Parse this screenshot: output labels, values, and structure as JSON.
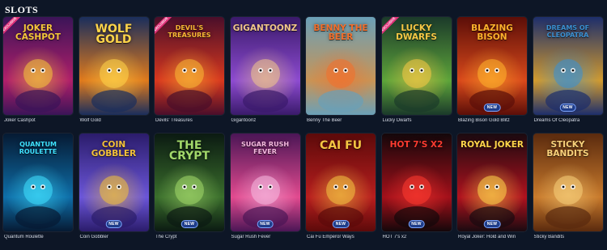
{
  "section": {
    "title": "SLOTS"
  },
  "games": [
    {
      "name": "Joker Cashpot",
      "logo": "JOKER CASHPOT",
      "tag": "EXCLUSIVE",
      "new": false
    },
    {
      "name": "Wolf Gold",
      "logo": "WOLF GOLD",
      "tag": "",
      "new": false
    },
    {
      "name": "Devils' Treasures",
      "logo": "DEVIL'S TREASURES",
      "tag": "EXCLUSIVE",
      "new": false
    },
    {
      "name": "Gigantoonz",
      "logo": "GIGANTOONZ",
      "tag": "",
      "new": false
    },
    {
      "name": "Benny The Beer",
      "logo": "BENNY the BEER",
      "tag": "",
      "new": false
    },
    {
      "name": "Lucky Dwarfs",
      "logo": "LUCKY DWARFS",
      "tag": "EXCLUSIVE",
      "new": false
    },
    {
      "name": "Blazing Bison Gold Blitz",
      "logo": "BLAZING BISON",
      "tag": "",
      "new": true
    },
    {
      "name": "Dreams Of Cleopatra",
      "logo": "DREAMS OF CLEOPATRA",
      "tag": "",
      "new": true
    },
    {
      "name": "Quantum Roulette",
      "logo": "QUANTUM ROULETTE",
      "tag": "",
      "new": false
    },
    {
      "name": "Coin Gobbler",
      "logo": "COIN GOBBLER",
      "tag": "",
      "new": true
    },
    {
      "name": "The Crypt",
      "logo": "THE CRYPT",
      "tag": "",
      "new": true
    },
    {
      "name": "Sugar Rush Fever",
      "logo": "SUGAR RUSH FEVER",
      "tag": "",
      "new": true
    },
    {
      "name": "Cai Fu Emperor Ways",
      "logo": "CAI FU",
      "tag": "",
      "new": true
    },
    {
      "name": "HOT 7's x2",
      "logo": "HOT 7's x2",
      "tag": "",
      "new": true
    },
    {
      "name": "Royal Joker: Hold and Win",
      "logo": "ROYAL JOKER",
      "tag": "",
      "new": true
    },
    {
      "name": "Sticky Bandits",
      "logo": "STICKY BANDITS",
      "tag": "",
      "new": false
    }
  ],
  "badges": {
    "new_label": "NEW"
  },
  "colors": {
    "background": "#0d1626",
    "card_palettes": [
      [
        "#3b1458",
        "#b01f6a",
        "#f5c63b"
      ],
      [
        "#1a2e5c",
        "#e07a1c",
        "#ffd54a"
      ],
      [
        "#4a0e2a",
        "#d9381e",
        "#f9b935"
      ],
      [
        "#3a1a6b",
        "#8d4bd0",
        "#f1c78a"
      ],
      [
        "#6aa0b8",
        "#c89456",
        "#f26f2c"
      ],
      [
        "#1b3a2a",
        "#5da43a",
        "#f7c845"
      ],
      [
        "#5b0e08",
        "#d9491b",
        "#ffb22c"
      ],
      [
        "#1d2e6b",
        "#d19a2f",
        "#3a8fd1"
      ],
      [
        "#061a33",
        "#0e6ea8",
        "#3fe0ff"
      ],
      [
        "#2b1c6b",
        "#6b56d9",
        "#f3c13a"
      ],
      [
        "#0b1a12",
        "#3a6e2c",
        "#a2d86a"
      ],
      [
        "#4b1656",
        "#e24a8f",
        "#f6b9e0"
      ],
      [
        "#5c0a0a",
        "#b81e1e",
        "#f4c542"
      ],
      [
        "#14070a",
        "#a3101a",
        "#ff3b30"
      ],
      [
        "#1a0a10",
        "#b0121e",
        "#ffd54a"
      ],
      [
        "#5a2a0e",
        "#c87a2c",
        "#f7d07a"
      ]
    ]
  }
}
